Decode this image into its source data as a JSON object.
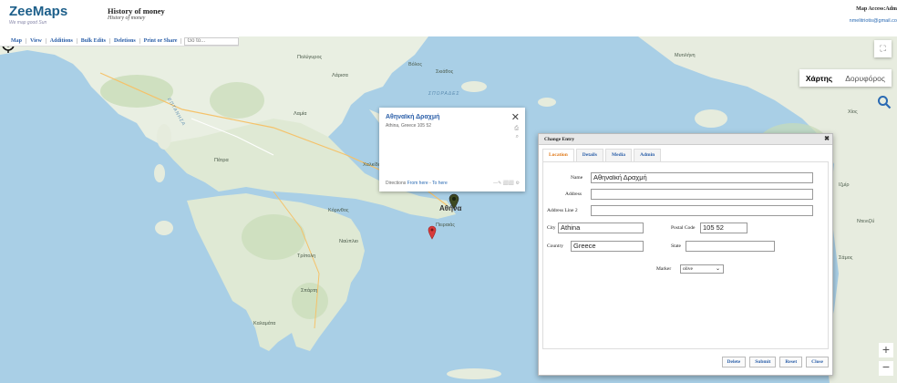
{
  "header": {
    "logo": "ZeeMaps",
    "tagline": "We map good Sun",
    "map_title": "History of money",
    "map_subtitle": "History of money",
    "access_label": "Map Access:Adm",
    "user_email": "nmelitriotis@gmail.co"
  },
  "menu": {
    "items": [
      "Map",
      "View",
      "Additions",
      "Bulk Edits",
      "Deletions",
      "Print or Share"
    ],
    "goto_placeholder": "Go to..."
  },
  "map": {
    "type_options": [
      "Χάρτης",
      "Δορυφόρος"
    ],
    "active_type": "Χάρτης",
    "places": [
      {
        "name": "Πολύγυρος",
        "cls": ""
      },
      {
        "name": "Βόλος",
        "cls": ""
      },
      {
        "name": "Λάρισα",
        "cls": ""
      },
      {
        "name": "Σκιάθος",
        "cls": ""
      },
      {
        "name": "Πάτρα",
        "cls": ""
      },
      {
        "name": "Λαμία",
        "cls": ""
      },
      {
        "name": "Χαλκίδα",
        "cls": ""
      },
      {
        "name": "Καλαμάτα",
        "cls": ""
      },
      {
        "name": "Τρίπολη",
        "cls": ""
      },
      {
        "name": "Πειραιάς",
        "cls": ""
      },
      {
        "name": "Ναύπλιο",
        "cls": ""
      },
      {
        "name": "Σπάρτη",
        "cls": ""
      },
      {
        "name": "Κόρινθος",
        "cls": ""
      },
      {
        "name": "Μυτιλήνη",
        "cls": ""
      },
      {
        "name": "Ιζμίρ",
        "cls": ""
      },
      {
        "name": "Ντενιζλί",
        "cls": ""
      },
      {
        "name": "Σάμος",
        "cls": ""
      },
      {
        "name": "Χίος",
        "cls": ""
      },
      {
        "name": "ΣΠΟΡΑΔΕΣ",
        "cls": "sea"
      },
      {
        "name": "ΕΠΤΑΝΗΣΑ",
        "cls": "sea"
      }
    ],
    "city_label": "Αθήνα"
  },
  "popup": {
    "title": "Αθηναϊκή Δραχμή",
    "address": "Athina, Greece 105 52",
    "directions_prefix": "Directions",
    "directions_from": "From here",
    "directions_sep": " - ",
    "directions_to": "To here",
    "tools": "—✎ ⬜⬜ ⚙"
  },
  "dialog": {
    "title": "Change Entry",
    "tabs": [
      "Location",
      "Details",
      "Media",
      "Admin"
    ],
    "labels": {
      "name": "Name",
      "address": "Address",
      "address2": "Address Line 2",
      "city": "City",
      "postal": "Postal Code",
      "country": "Country",
      "state": "State",
      "marker": "Marker"
    },
    "values": {
      "name": "Αθηναϊκή Δραχμή",
      "address": "",
      "address2": "",
      "city": "Athina",
      "postal": "105 52",
      "country": "Greece",
      "state": "",
      "marker": "olive"
    },
    "buttons": [
      "Delete",
      "Submit",
      "Reset",
      "Close"
    ]
  }
}
